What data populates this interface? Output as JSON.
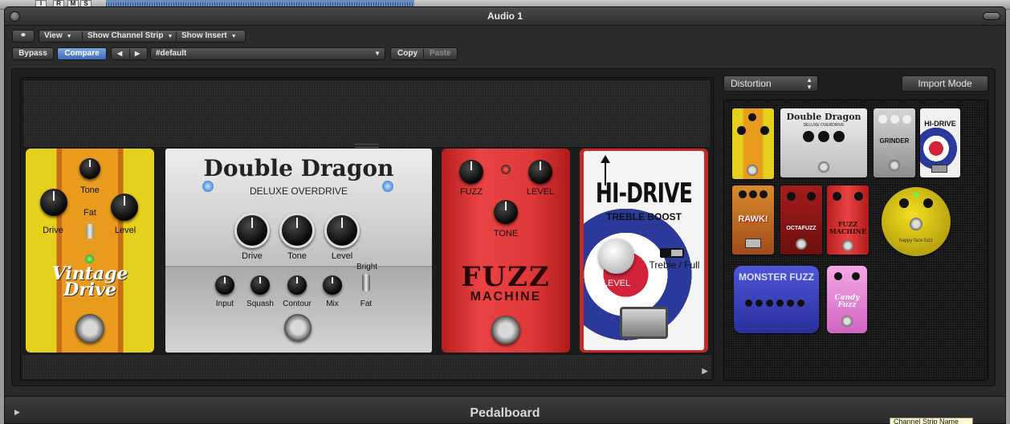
{
  "host": {
    "buttons": [
      "I",
      "R",
      "M",
      "S"
    ]
  },
  "window": {
    "title": "Audio 1"
  },
  "toolbar": {
    "view": "View",
    "show_channel_strip": "Show Channel Strip",
    "show_insert": "Show Insert",
    "bypass": "Bypass",
    "compare": "Compare",
    "prev": "◀",
    "next": "▶",
    "preset": "#default",
    "copy": "Copy",
    "paste": "Paste"
  },
  "pedals": {
    "vintage_drive": {
      "tone": "Tone",
      "fat": "Fat",
      "drive": "Drive",
      "level": "Level",
      "name_line1": "Vintage",
      "name_line2": "Drive"
    },
    "double_dragon": {
      "name": "Double Dragon",
      "subtitle": "DELUXE OVERDRIVE",
      "drive": "Drive",
      "tone": "Tone",
      "level": "Level",
      "input": "Input",
      "squash": "Squash",
      "contour": "Contour",
      "mix": "Mix",
      "bright": "Bright",
      "fat": "Fat"
    },
    "fuzz_machine": {
      "fuzz": "FUZZ",
      "level": "LEVEL",
      "tone": "TONE",
      "name_line1": "FUZZ",
      "name_line2": "MACHINE"
    },
    "hi_drive": {
      "name": "HI-DRIVE",
      "subtitle": "TREBLE BOOST",
      "level": "LEVEL",
      "switch": "Treble / Full"
    }
  },
  "browser": {
    "category": "Distortion",
    "import_mode": "Import Mode",
    "thumbs": {
      "double_dragon": "Double Dragon",
      "double_dragon_sub": "DELUXE OVERDRIVE",
      "grinder": "GRINDER",
      "hi_drive": "HI-DRIVE",
      "rawk": "RAWK!",
      "octafuzz": "OCTAFUZZ",
      "fuzz_machine": "FUZZ MACHINE",
      "happy_face": "happy face fuzz",
      "monster_fuzz": "MONSTER FUZZ",
      "candy_fuzz": "Candy Fuzz"
    }
  },
  "footer": {
    "title": "Pedalboard",
    "tooltip": "Channel Strip Name"
  },
  "colors": {
    "compare_active": "#4a7bc4",
    "window_bg": "#2b2b2b"
  }
}
